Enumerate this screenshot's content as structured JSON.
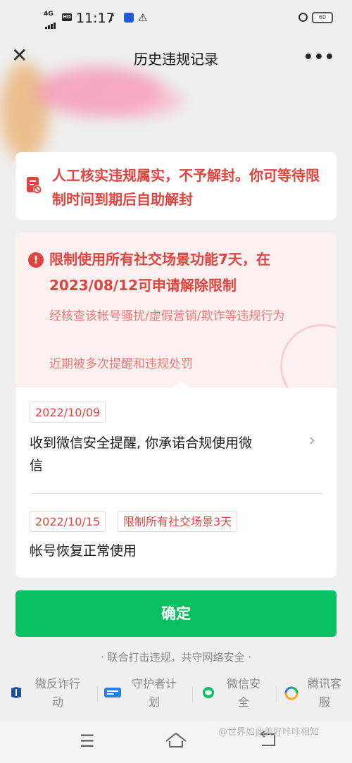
{
  "status_bar": {
    "network": "4G",
    "hd": "HD",
    "time": "11:17",
    "battery": "60"
  },
  "header": {
    "title": "历史违规记录",
    "close_icon": "close-icon",
    "more_icon": "more-icon"
  },
  "verdict_card": {
    "text": "人工核实违规属实，不予解封。你可等待限制时间到期后自助解封",
    "icon": "document-ban-icon"
  },
  "restriction_card": {
    "title": "限制使用所有社交场景功能7天，在2023/08/12可申请解除限制",
    "reasons": [
      "经核查该帐号骚扰/虚假营销/欺诈等违规行为",
      "近期被多次提醒和违规处罚"
    ]
  },
  "history": [
    {
      "date": "2022/10/09",
      "text_line1": "收到微信安全提醒, 你承诺合规使用微",
      "text_line2": "信"
    },
    {
      "date": "2022/10/15",
      "tag": "限制所有社交场景3天",
      "text_line1": "帐号恢复正常使用"
    }
  ],
  "confirm_button": "确定",
  "slogan": "· 联合打击违规，共守网络安全 ·",
  "footer_links": [
    {
      "line1": "微反诈行",
      "line2": "动",
      "icon": "anti-fraud-icon"
    },
    {
      "line1": "守护者计",
      "line2": "划",
      "icon": "guardian-icon"
    },
    {
      "line1": "微信安",
      "line2": "全",
      "icon": "wechat-security-icon"
    },
    {
      "line1": "腾讯客",
      "line2": "服",
      "icon": "tencent-service-icon"
    }
  ],
  "watermark": "@世界如此美好咔咔相知",
  "colors": {
    "accent_red": "#e0443e",
    "primary_green": "#07c160"
  }
}
